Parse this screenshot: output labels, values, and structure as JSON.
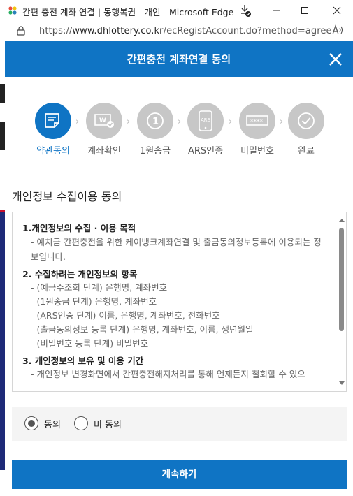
{
  "browser": {
    "window_title": "간편 충전 계좌 연결 | 동행복권 - 개인 - Microsoft Edge",
    "url_prefix": "https://",
    "url_domain": "www.dhlottery.co.kr",
    "url_path": "/ecRegistAccount.do?method=agree",
    "read_aloud": "A̅",
    "minimize": "—",
    "maximize": "☐",
    "close": "✕"
  },
  "popup": {
    "title": "간편충전 계좌연결 동의",
    "steps": [
      {
        "label": "약관동의",
        "icon": "document-icon",
        "active": true
      },
      {
        "label": "계좌확인",
        "icon": "account-check-icon",
        "active": false
      },
      {
        "label": "1원송금",
        "icon": "one-won-icon",
        "active": false
      },
      {
        "label": "ARS인증",
        "icon": "ars-phone-icon",
        "active": false
      },
      {
        "label": "비밀번호",
        "icon": "password-icon",
        "active": false
      },
      {
        "label": "완료",
        "icon": "checkmark-icon",
        "active": false
      }
    ],
    "section_title": "개인정보 수집이용 동의",
    "terms": {
      "h1": "1.개인정보의 수집 · 이용 목적",
      "p1": "- 예치금 간편충전을 위한 케이뱅크계좌연결 및 출금동의정보등록에 이용되는 정보입니다.",
      "h2": "2. 수집하려는 개인정보의 항목",
      "items": [
        "- (예금주조회 단계) 은행명, 계좌번호",
        "- (1원송금 단계) 은행명, 계좌번호",
        "- (ARS인증 단계) 이름, 은행명, 계좌번호, 전화번호",
        "- (출금동의정보 등록 단계) 은행명, 계좌번호, 이름, 생년월일",
        "- (비밀번호 등록 단계) 비밀번호"
      ],
      "h3": "3. 개인정보의 보유 및 이용 기간",
      "p3": "- 개인정보 변경화면에서 간편충전해지처리를 통해 언제든지 철회할 수 있으"
    },
    "agree_label": "동의",
    "disagree_label": "비 동의",
    "agree_selected": true,
    "continue_label": "계속하기",
    "colors": {
      "primary": "#0f74c4",
      "inactive_step": "#c7c7c7"
    }
  }
}
